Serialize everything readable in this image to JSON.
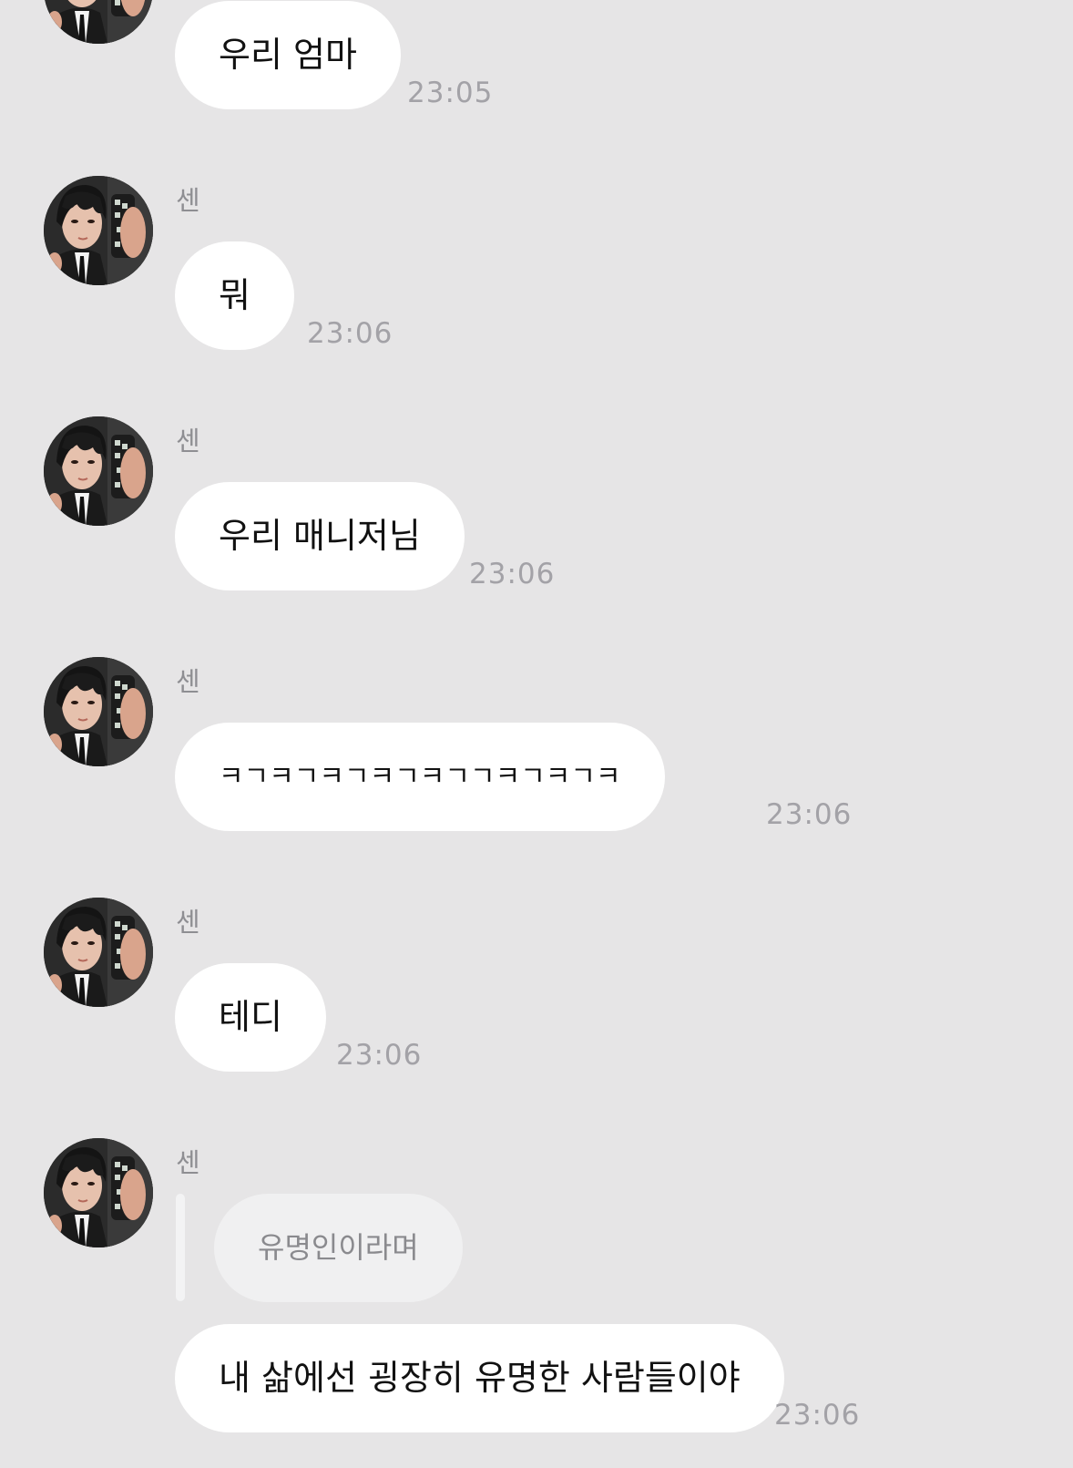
{
  "messages": [
    {
      "sender": "",
      "text": "우리 엄마",
      "time": "23:05"
    },
    {
      "sender": "센",
      "text": "뭐",
      "time": "23:06"
    },
    {
      "sender": "센",
      "text": "우리 매니저님",
      "time": "23:06"
    },
    {
      "sender": "센",
      "text": "ㅋㄱㅋㄱㅋㄱㅋㄱㅋㄱㄱㅋㄱㅋㄱㅋ",
      "time": "23:06"
    },
    {
      "sender": "센",
      "text": "테디",
      "time": "23:06"
    },
    {
      "sender": "센",
      "quoted": "유명인이라며",
      "text": "내 삶에선 굉장히 유명한 사람들이야",
      "time": "23:06"
    }
  ]
}
